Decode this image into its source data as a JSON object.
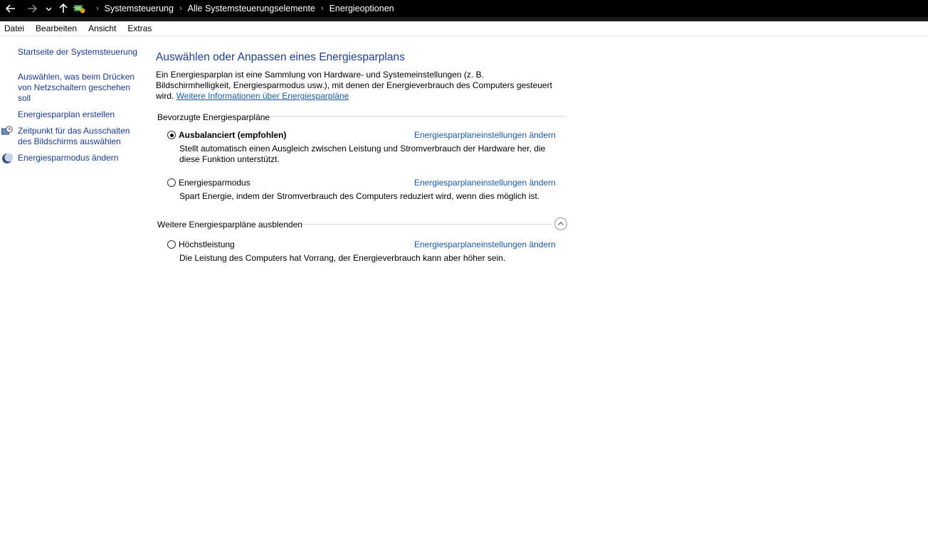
{
  "address_bar": {
    "crumbs": [
      "Systemsteuerung",
      "Alle Systemsteuerungselemente",
      "Energieoptionen"
    ],
    "separator": "›"
  },
  "menu": [
    "Datei",
    "Bearbeiten",
    "Ansicht",
    "Extras"
  ],
  "sidebar": {
    "items": [
      {
        "label": "Startseite der Systemsteuerung"
      },
      {
        "label": "Auswählen, was beim Drücken von Netzschaltern geschehen soll"
      },
      {
        "label": "Energiesparplan erstellen"
      },
      {
        "label": "Zeitpunkt für das Ausschalten des Bildschirms auswählen",
        "icon": "monitor-clock-icon"
      },
      {
        "label": "Energiesparmodus ändern",
        "icon": "moon-icon"
      }
    ]
  },
  "main": {
    "title": "Auswählen oder Anpassen eines Energiesparplans",
    "intro_text": "Ein Energiesparplan ist eine Sammlung von Hardware- und Systemeinstellungen (z. B. Bildschirmhelligkeit, Energiesparmodus usw.), mit denen der Energieverbrauch des Computers gesteuert wird.",
    "intro_link": "Weitere Informationen über Energiesparpläne",
    "preferred_section": "Bevorzugte Energiesparpläne",
    "more_section": "Weitere Energiesparpläne ausblenden",
    "plans": [
      {
        "name": "Ausbalanciert (empfohlen)",
        "selected": true,
        "description": "Stellt automatisch einen Ausgleich zwischen Leistung und Stromverbrauch der Hardware her, die diese Funktion unterstützt.",
        "link": "Energiesparplaneinstellungen ändern"
      },
      {
        "name": "Energiesparmodus",
        "selected": false,
        "description": "Spart Energie, indem der Stromverbrauch des Computers reduziert wird, wenn dies möglich ist.",
        "link": "Energiesparplaneinstellungen ändern"
      },
      {
        "name": "Höchstleistung",
        "selected": false,
        "description": "Die Leistung des Computers hat Vorrang, der Energieverbrauch kann aber höher sein.",
        "link": "Energiesparplaneinstellungen ändern"
      }
    ]
  }
}
